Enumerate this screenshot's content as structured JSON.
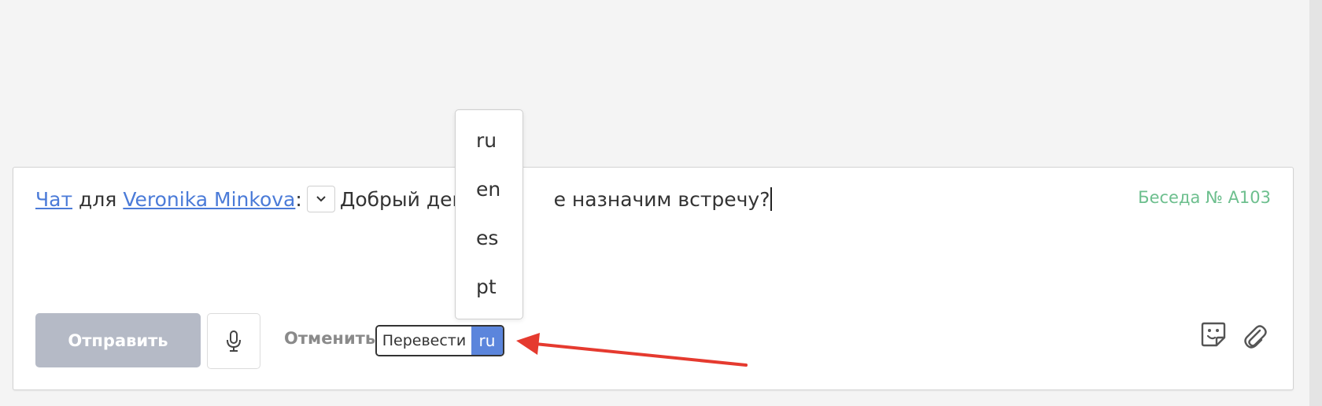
{
  "composer": {
    "chat_link": "Чат",
    "for_word": "для",
    "contact_link": "Veronika Minkova",
    "colon": ":",
    "message_before": "Добрый день, ",
    "message_after": "е назначим встречу?",
    "conversation_label": "Беседа № А103",
    "conversation_color": "#6dbf8e"
  },
  "toolbar": {
    "send_label": "Отправить",
    "cancel_label": "Отменить",
    "translate_label": "Перевести",
    "translate_lang": "ru",
    "accent_color": "#5b85dc",
    "icons": [
      "microphone-icon",
      "chevron-down-icon",
      "sticker-icon",
      "paperclip-icon"
    ]
  },
  "language_dropdown": {
    "options": [
      "ru",
      "en",
      "es",
      "pt"
    ]
  },
  "annotation": {
    "arrow_color": "#e53a2f"
  }
}
